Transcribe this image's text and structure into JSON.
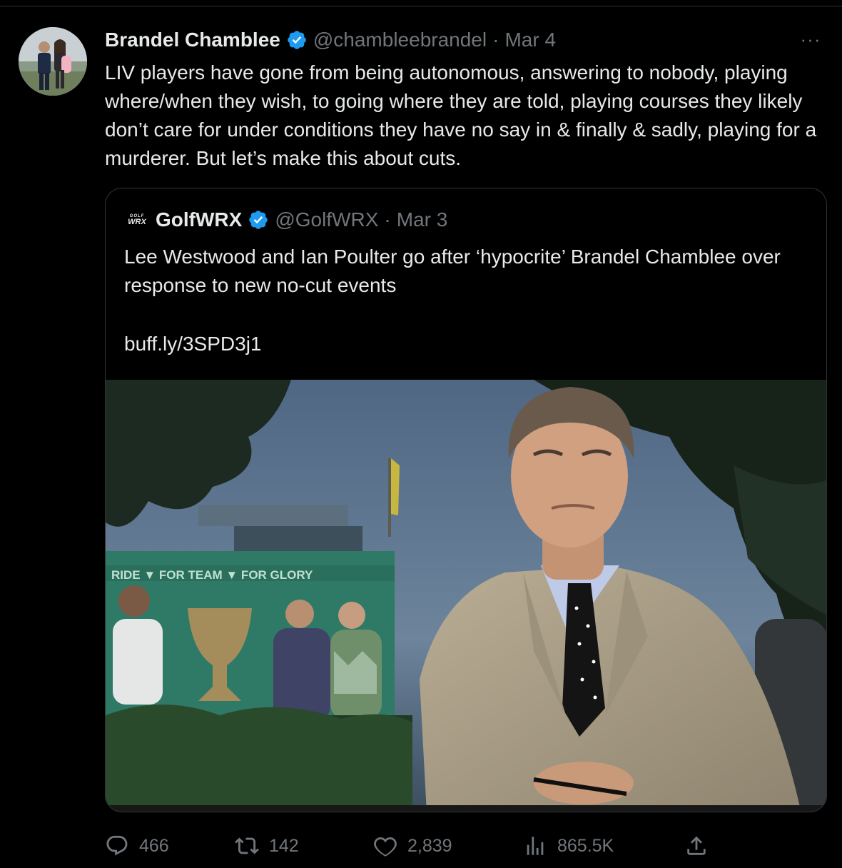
{
  "tweet": {
    "author": {
      "display_name": "Brandel Chamblee",
      "handle": "@chambleebrandel",
      "separator": "·",
      "date": "Mar 4",
      "verified": true
    },
    "more_icon": "more-horizontal-icon",
    "more_label": "···",
    "text": "LIV players have gone from being autonomous, answering to nobody, playing where/when they wish, to going where they are told, playing courses they likely don’t care for under conditions they have no say in & finally & sadly, playing for a murderer. But let’s make this about cuts.",
    "quote": {
      "logo_top": "GOLF",
      "logo_bottom": "WRX",
      "display_name": "GolfWRX",
      "handle": "@GolfWRX",
      "separator": "·",
      "date": "Mar 3",
      "verified": true,
      "text": "Lee Westwood and Ian Poulter go after ‘hypocrite’ Brandel Chamblee over response to new no-cut events",
      "link": "buff.ly/3SPD3j1",
      "image": {
        "description_icon": "photo",
        "banner_text": "RIDE  ▼ FOR TEAM  ▼ FOR GLORY"
      }
    },
    "metrics": {
      "replies": "466",
      "retweets": "142",
      "likes": "2,839",
      "views": "865.5K"
    },
    "colors": {
      "background": "#000000",
      "text": "#e7e9ea",
      "secondary": "#71767b",
      "border": "#2f3336",
      "verified": "#1d9bf0"
    }
  }
}
